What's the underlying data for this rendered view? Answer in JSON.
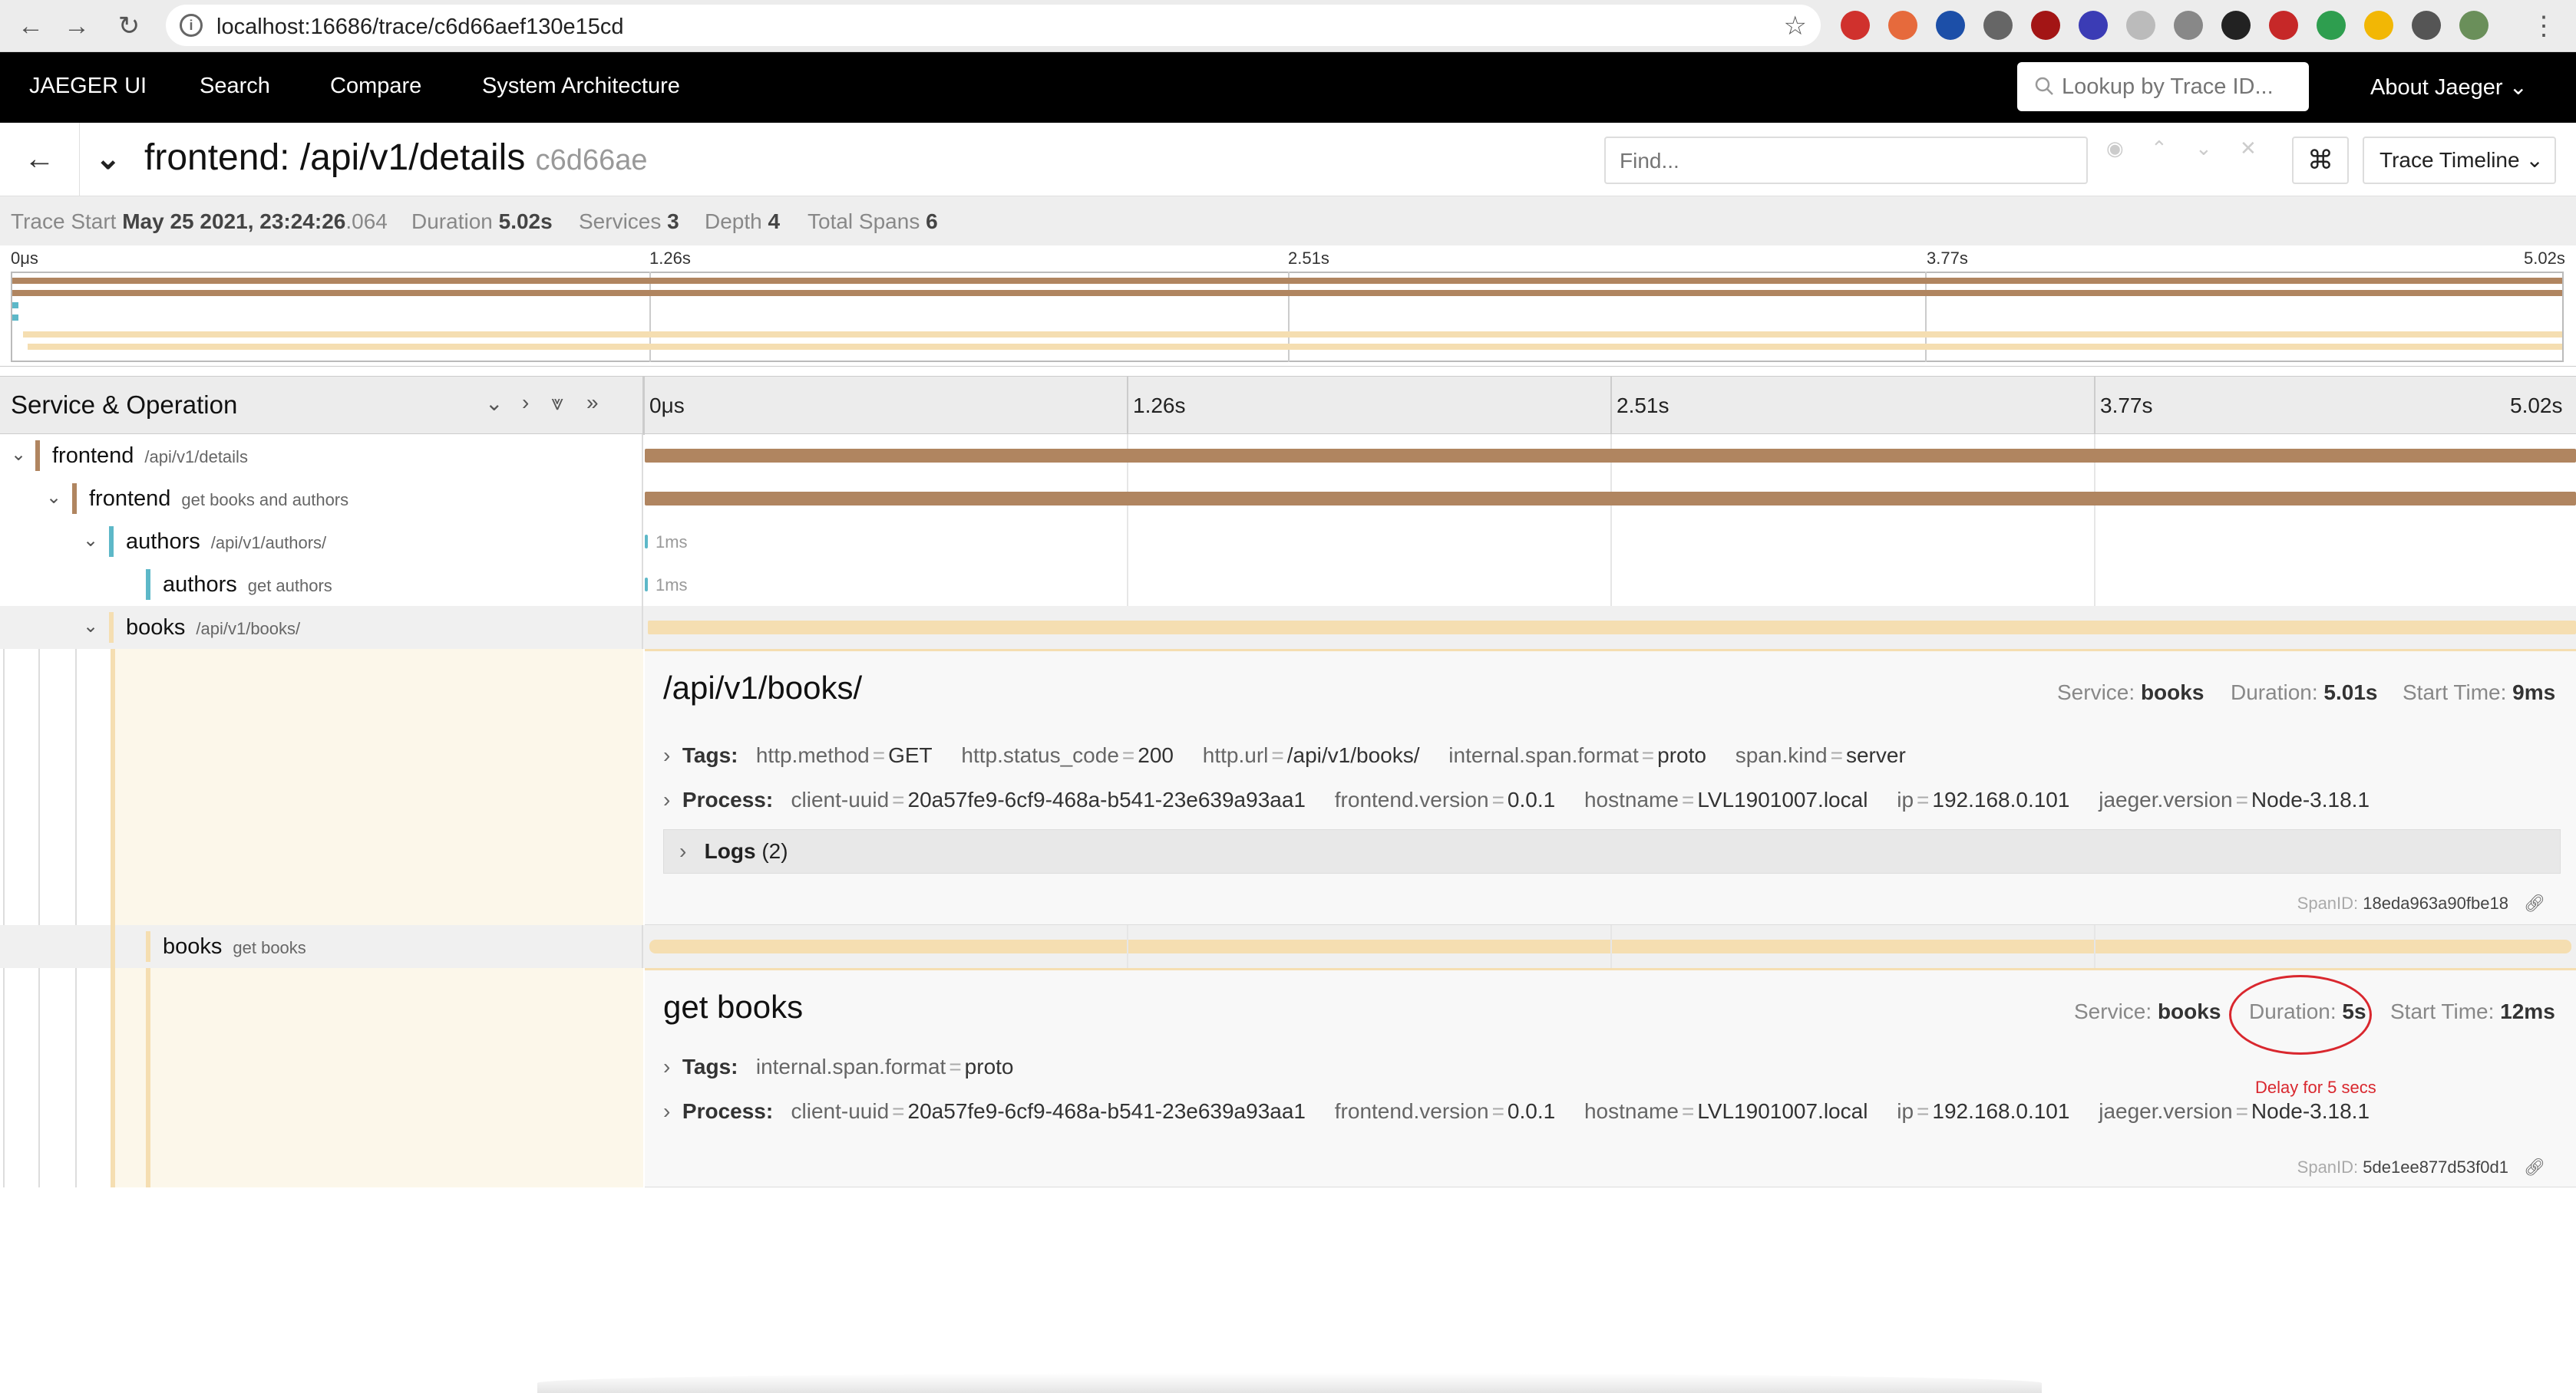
{
  "browser": {
    "url": "localhost:16686/trace/c6d66aef130e15cd",
    "back": "←",
    "forward": "→",
    "reload": "↻",
    "star": "☆"
  },
  "nav": {
    "brand": "JAEGER UI",
    "items": [
      "Search",
      "Compare",
      "System Architecture"
    ],
    "lookup_placeholder": "Lookup by Trace ID...",
    "about": "About Jaeger ⌄"
  },
  "trace": {
    "service": "frontend:",
    "operation": "/api/v1/details",
    "id": "c6d66ae",
    "find_placeholder": "Find...",
    "view_mode": "Trace Timeline ⌄"
  },
  "summary": {
    "start_label": "Trace Start",
    "start_value": "May 25 2021, 23:24:26",
    "start_ms": ".064",
    "duration_label": "Duration",
    "duration_value": "5.02s",
    "services_label": "Services",
    "services_value": "3",
    "depth_label": "Depth",
    "depth_value": "4",
    "spans_label": "Total Spans",
    "spans_value": "6"
  },
  "ticks": [
    "0μs",
    "1.26s",
    "2.51s",
    "3.77s",
    "5.02s"
  ],
  "colors": {
    "frontend": "#b08560",
    "authors": "#5db8c8",
    "books": "#f5deb1"
  },
  "timeline": {
    "header": "Service & Operation"
  },
  "spans": [
    {
      "service": "frontend",
      "operation": "/api/v1/details",
      "duration_label": ""
    },
    {
      "service": "frontend",
      "operation": "get books and authors",
      "duration_label": ""
    },
    {
      "service": "authors",
      "operation": "/api/v1/authors/",
      "duration_label": "1ms"
    },
    {
      "service": "authors",
      "operation": "get authors",
      "duration_label": "1ms"
    },
    {
      "service": "books",
      "operation": "/api/v1/books/",
      "duration_label": ""
    },
    {
      "service": "books",
      "operation": "get books",
      "duration_label": ""
    }
  ],
  "detail1": {
    "title": "/api/v1/books/",
    "service_label": "Service:",
    "service": "books",
    "duration_label": "Duration:",
    "duration": "5.01s",
    "start_label": "Start Time:",
    "start": "9ms",
    "tags_label": "Tags:",
    "tags": [
      {
        "k": "http.method",
        "v": "GET"
      },
      {
        "k": "http.status_code",
        "v": "200"
      },
      {
        "k": "http.url",
        "v": "/api/v1/books/"
      },
      {
        "k": "internal.span.format",
        "v": "proto"
      },
      {
        "k": "span.kind",
        "v": "server"
      }
    ],
    "process_label": "Process:",
    "process": [
      {
        "k": "client-uuid",
        "v": "20a57fe9-6cf9-468a-b541-23e639a93aa1"
      },
      {
        "k": "frontend.version",
        "v": "0.0.1"
      },
      {
        "k": "hostname",
        "v": "LVL1901007.local"
      },
      {
        "k": "ip",
        "v": "192.168.0.101"
      },
      {
        "k": "jaeger.version",
        "v": "Node-3.18.1"
      }
    ],
    "logs_label": "Logs",
    "logs_count": "(2)",
    "spanid_label": "SpanID:",
    "spanid": "18eda963a90fbe18"
  },
  "detail2": {
    "title": "get books",
    "service_label": "Service:",
    "service": "books",
    "duration_label": "Duration:",
    "duration": "5s",
    "start_label": "Start Time:",
    "start": "12ms",
    "tags_label": "Tags:",
    "tags": [
      {
        "k": "internal.span.format",
        "v": "proto"
      }
    ],
    "process_label": "Process:",
    "process": [
      {
        "k": "client-uuid",
        "v": "20a57fe9-6cf9-468a-b541-23e639a93aa1"
      },
      {
        "k": "frontend.version",
        "v": "0.0.1"
      },
      {
        "k": "hostname",
        "v": "LVL1901007.local"
      },
      {
        "k": "ip",
        "v": "192.168.0.101"
      },
      {
        "k": "jaeger.version",
        "v": "Node-3.18.1"
      }
    ],
    "annotation": "Delay for 5 secs",
    "spanid_label": "SpanID:",
    "spanid": "5de1ee877d53f0d1"
  }
}
